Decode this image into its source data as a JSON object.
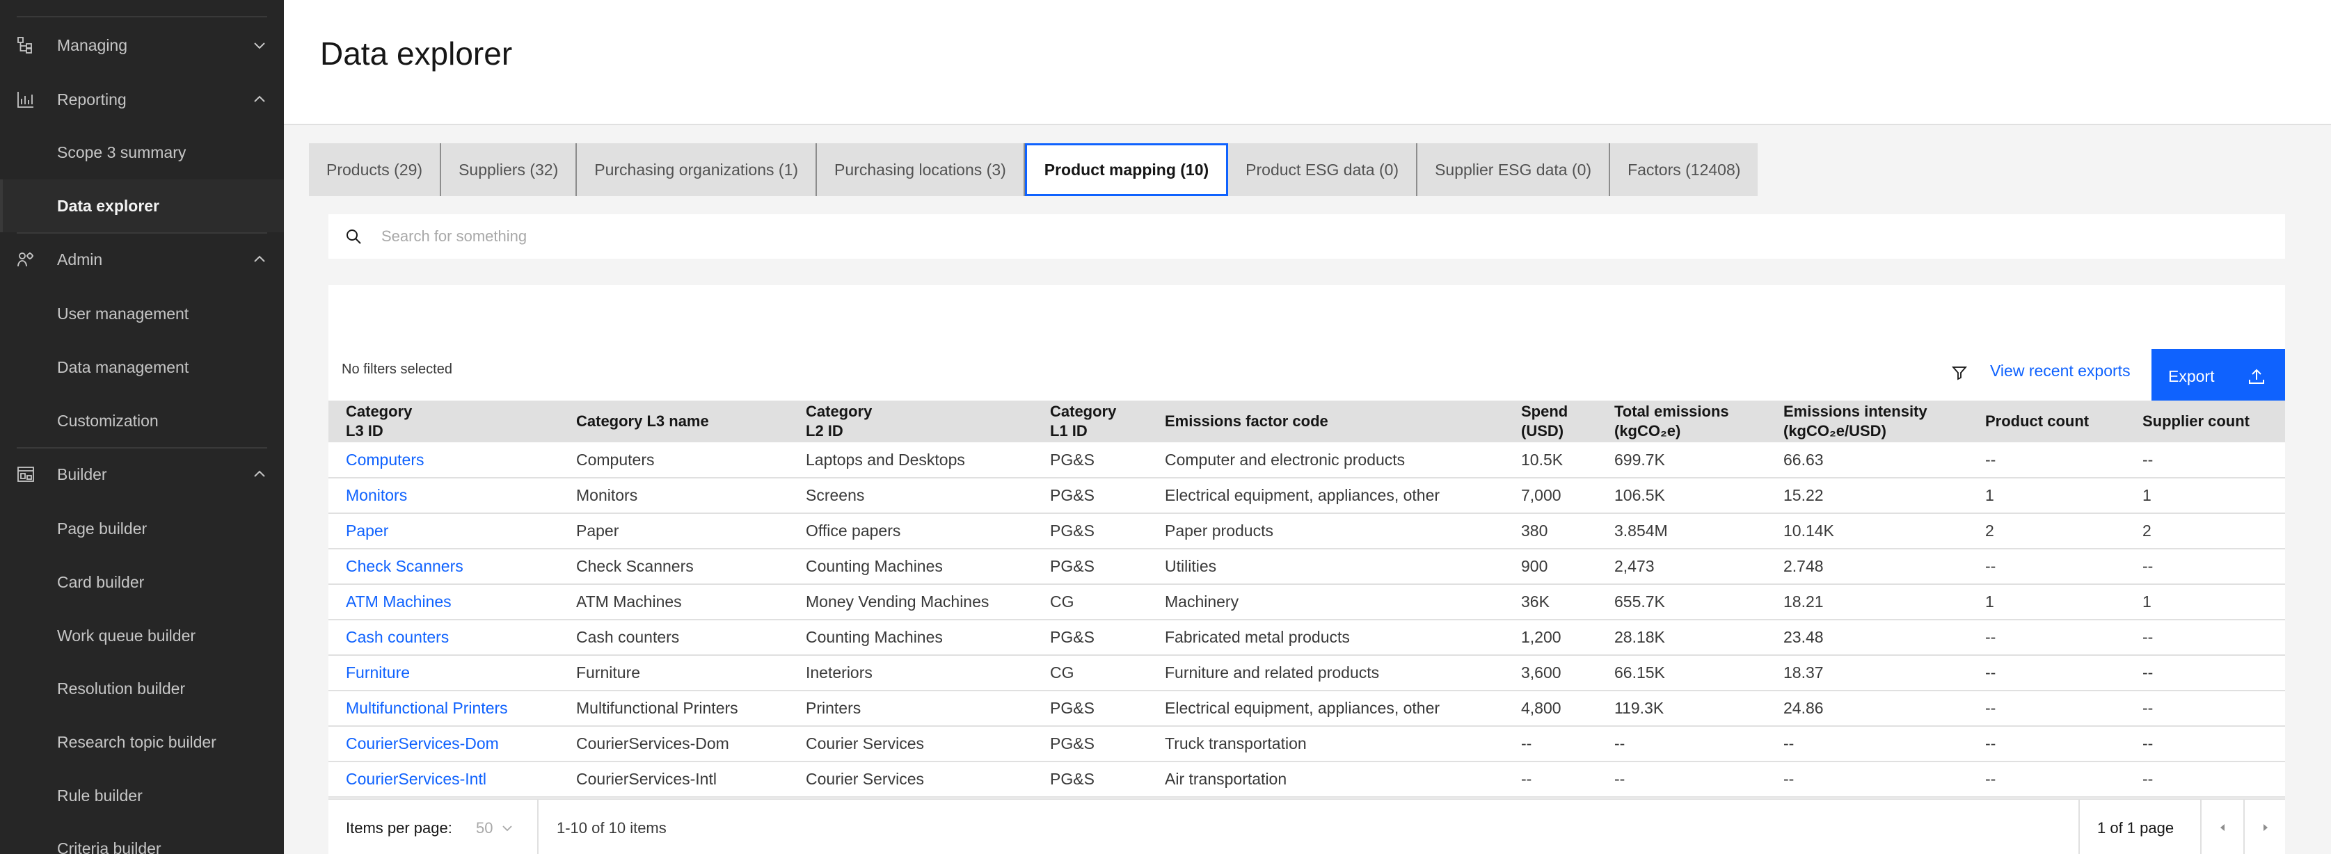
{
  "sidebar": {
    "groups": [
      {
        "label": "Managing",
        "icon": "hierarchy-icon",
        "expanded": false
      },
      {
        "label": "Reporting",
        "icon": "bar-chart-icon",
        "expanded": true
      },
      {
        "label": "Admin",
        "icon": "user-admin-icon",
        "expanded": true
      },
      {
        "label": "Builder",
        "icon": "builder-icon",
        "expanded": true
      }
    ],
    "items": {
      "scope3": "Scope 3 summary",
      "data_explorer": "Data explorer",
      "user_management": "User management",
      "data_management": "Data management",
      "customization": "Customization",
      "page_builder": "Page builder",
      "card_builder": "Card builder",
      "work_queue_builder": "Work queue builder",
      "resolution_builder": "Resolution builder",
      "research_topic_builder": "Research topic builder",
      "rule_builder": "Rule builder",
      "criteria_builder": "Criteria builder"
    }
  },
  "header": {
    "title": "Data explorer"
  },
  "tabs": [
    {
      "label": "Products (29)",
      "active": false
    },
    {
      "label": "Suppliers (32)",
      "active": false
    },
    {
      "label": "Purchasing organizations (1)",
      "active": false
    },
    {
      "label": "Purchasing locations (3)",
      "active": false
    },
    {
      "label": "Product mapping (10)",
      "active": true
    },
    {
      "label": "Product ESG data (0)",
      "active": false
    },
    {
      "label": "Supplier ESG data (0)",
      "active": false
    },
    {
      "label": "Factors (12408)",
      "active": false
    }
  ],
  "search": {
    "placeholder": "Search for something",
    "value": ""
  },
  "toolbar": {
    "filters_status": "No filters selected",
    "recent_exports_label": "View recent exports",
    "export_label": "Export"
  },
  "table": {
    "columns": [
      [
        "Category",
        "L3 ID"
      ],
      [
        "Category L3 name"
      ],
      [
        "Category",
        "L2 ID"
      ],
      [
        "Category",
        "L1 ID"
      ],
      [
        "Emissions factor code"
      ],
      [
        "Spend",
        "(USD)"
      ],
      [
        "Total emissions",
        "(kgCO₂e)"
      ],
      [
        "Emissions intensity",
        "(kgCO₂e/USD)"
      ],
      [
        "Product count"
      ],
      [
        "Supplier count"
      ]
    ],
    "rows": [
      [
        "Computers",
        "Computers",
        "Laptops and Desktops",
        "PG&S",
        "Computer and electronic products",
        "10.5K",
        "699.7K",
        "66.63",
        "--",
        "--"
      ],
      [
        "Monitors",
        "Monitors",
        "Screens",
        "PG&S",
        "Electrical equipment, appliances, other",
        "7,000",
        "106.5K",
        "15.22",
        "1",
        "1"
      ],
      [
        "Paper",
        "Paper",
        "Office papers",
        "PG&S",
        "Paper products",
        "380",
        "3.854M",
        "10.14K",
        "2",
        "2"
      ],
      [
        "Check Scanners",
        "Check Scanners",
        "Counting Machines",
        "PG&S",
        "Utilities",
        "900",
        "2,473",
        "2.748",
        "--",
        "--"
      ],
      [
        "ATM Machines",
        "ATM Machines",
        "Money Vending Machines",
        "CG",
        "Machinery",
        "36K",
        "655.7K",
        "18.21",
        "1",
        "1"
      ],
      [
        "Cash counters",
        "Cash counters",
        "Counting Machines",
        "PG&S",
        "Fabricated metal products",
        "1,200",
        "28.18K",
        "23.48",
        "--",
        "--"
      ],
      [
        "Furniture",
        "Furniture",
        "Ineteriors",
        "CG",
        "Furniture and related products",
        "3,600",
        "66.15K",
        "18.37",
        "--",
        "--"
      ],
      [
        "Multifunctional Printers",
        "Multifunctional Printers",
        "Printers",
        "PG&S",
        "Electrical equipment, appliances, other",
        "4,800",
        "119.3K",
        "24.86",
        "--",
        "--"
      ],
      [
        "CourierServices-Dom",
        "CourierServices-Dom",
        "Courier Services",
        "PG&S",
        "Truck transportation",
        "--",
        "--",
        "--",
        "--",
        "--"
      ],
      [
        "CourierServices-Intl",
        "CourierServices-Intl",
        "Courier Services",
        "PG&S",
        "Air transportation",
        "--",
        "--",
        "--",
        "--",
        "--"
      ]
    ]
  },
  "pagination": {
    "items_per_page_label": "Items per page:",
    "items_per_page_value": "50",
    "range_label": "1-10 of 10 items",
    "pages_label": "1 of 1 page"
  },
  "colors": {
    "accent": "#0f62fe",
    "sidebar_bg": "#262626",
    "page_bg": "#f4f4f4"
  }
}
